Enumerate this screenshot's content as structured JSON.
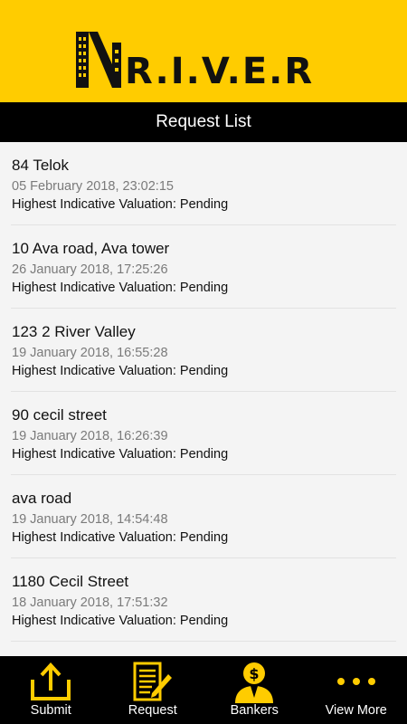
{
  "app": {
    "logo_text": "R.I.V.E.R",
    "brand_color": "#ffcc00"
  },
  "titlebar": {
    "title": "Request List"
  },
  "requests": [
    {
      "title": "84 Telok",
      "date": "05 February 2018, 23:02:15",
      "valuation": "Highest Indicative Valuation: Pending"
    },
    {
      "title": "10 Ava road, Ava tower",
      "date": "26 January 2018, 17:25:26",
      "valuation": "Highest Indicative Valuation: Pending"
    },
    {
      "title": "123 2 River Valley",
      "date": "19 January 2018, 16:55:28",
      "valuation": "Highest Indicative Valuation: Pending"
    },
    {
      "title": "90 cecil street",
      "date": "19 January 2018, 16:26:39",
      "valuation": "Highest Indicative Valuation: Pending"
    },
    {
      "title": "ava road",
      "date": "19 January 2018, 14:54:48",
      "valuation": "Highest Indicative Valuation: Pending"
    },
    {
      "title": "1180 Cecil Street",
      "date": "18 January 2018, 17:51:32",
      "valuation": "Highest Indicative Valuation: Pending"
    }
  ],
  "navbar": {
    "items": [
      {
        "label": "Submit",
        "icon": "upload-icon"
      },
      {
        "label": "Request",
        "icon": "document-pen-icon"
      },
      {
        "label": "Bankers",
        "icon": "banker-icon"
      },
      {
        "label": "View More",
        "icon": "more-dots-icon"
      }
    ]
  }
}
